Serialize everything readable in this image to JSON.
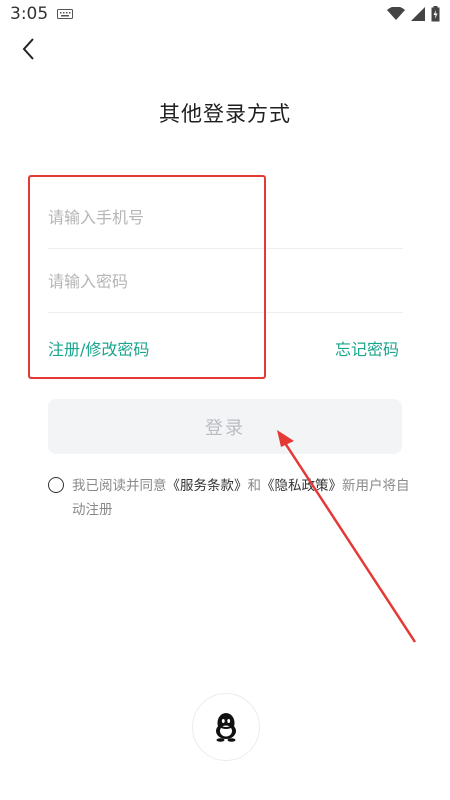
{
  "status": {
    "time": "3:05"
  },
  "header": {
    "title": "其他登录方式"
  },
  "form": {
    "phone_placeholder": "请输入手机号",
    "password_placeholder": "请输入密码",
    "register_link": "注册/修改密码",
    "forgot_link": "忘记密码",
    "login_label": "登录"
  },
  "agreement": {
    "prefix": "我已阅读并同意",
    "terms": "《服务条款》",
    "and": "和",
    "privacy": "《隐私政策》",
    "suffix": "新用户将自动注册"
  },
  "social": {
    "icon": "qq-icon"
  },
  "colors": {
    "accent": "#1aa58d",
    "annotation": "#e53935"
  }
}
